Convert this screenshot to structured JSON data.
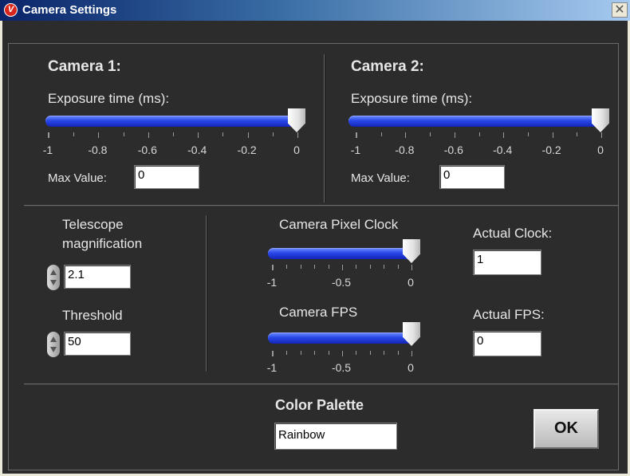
{
  "window": {
    "title": "Camera Settings",
    "icon_glyph": "V",
    "close_glyph": "✕"
  },
  "camera1": {
    "heading": "Camera 1:",
    "exposure_label": "Exposure time (ms):",
    "slider_ticks": [
      "-1",
      "-0.8",
      "-0.6",
      "-0.4",
      "-0.2",
      "0"
    ],
    "slider_value": 0,
    "slider_min": -1,
    "slider_max": 0,
    "max_value_label": "Max Value:",
    "max_value": "0"
  },
  "camera2": {
    "heading": "Camera 2:",
    "exposure_label": "Exposure time (ms):",
    "slider_ticks": [
      "-1",
      "-0.8",
      "-0.6",
      "-0.4",
      "-0.2",
      "0"
    ],
    "slider_value": 0,
    "slider_min": -1,
    "slider_max": 0,
    "max_value_label": "Max Value:",
    "max_value": "0"
  },
  "telescope": {
    "label_line1": "Telescope",
    "label_line2": "magnification",
    "value": "2.1"
  },
  "threshold": {
    "label": "Threshold",
    "value": "50"
  },
  "pixel_clock": {
    "label": "Camera Pixel Clock",
    "slider_ticks": [
      "-1",
      "-0.5",
      "0"
    ],
    "slider_value": 0,
    "actual_label": "Actual Clock:",
    "actual_value": "1"
  },
  "fps": {
    "label": "Camera FPS",
    "slider_ticks": [
      "-1",
      "-0.5",
      "0"
    ],
    "slider_value": 0,
    "actual_label": "Actual FPS:",
    "actual_value": "0"
  },
  "palette": {
    "label": "Color Palette",
    "value": "Rainbow"
  },
  "ok_label": "OK",
  "colors": {
    "panel": "#2c2c2c",
    "slider_fill": "#2948e8"
  }
}
